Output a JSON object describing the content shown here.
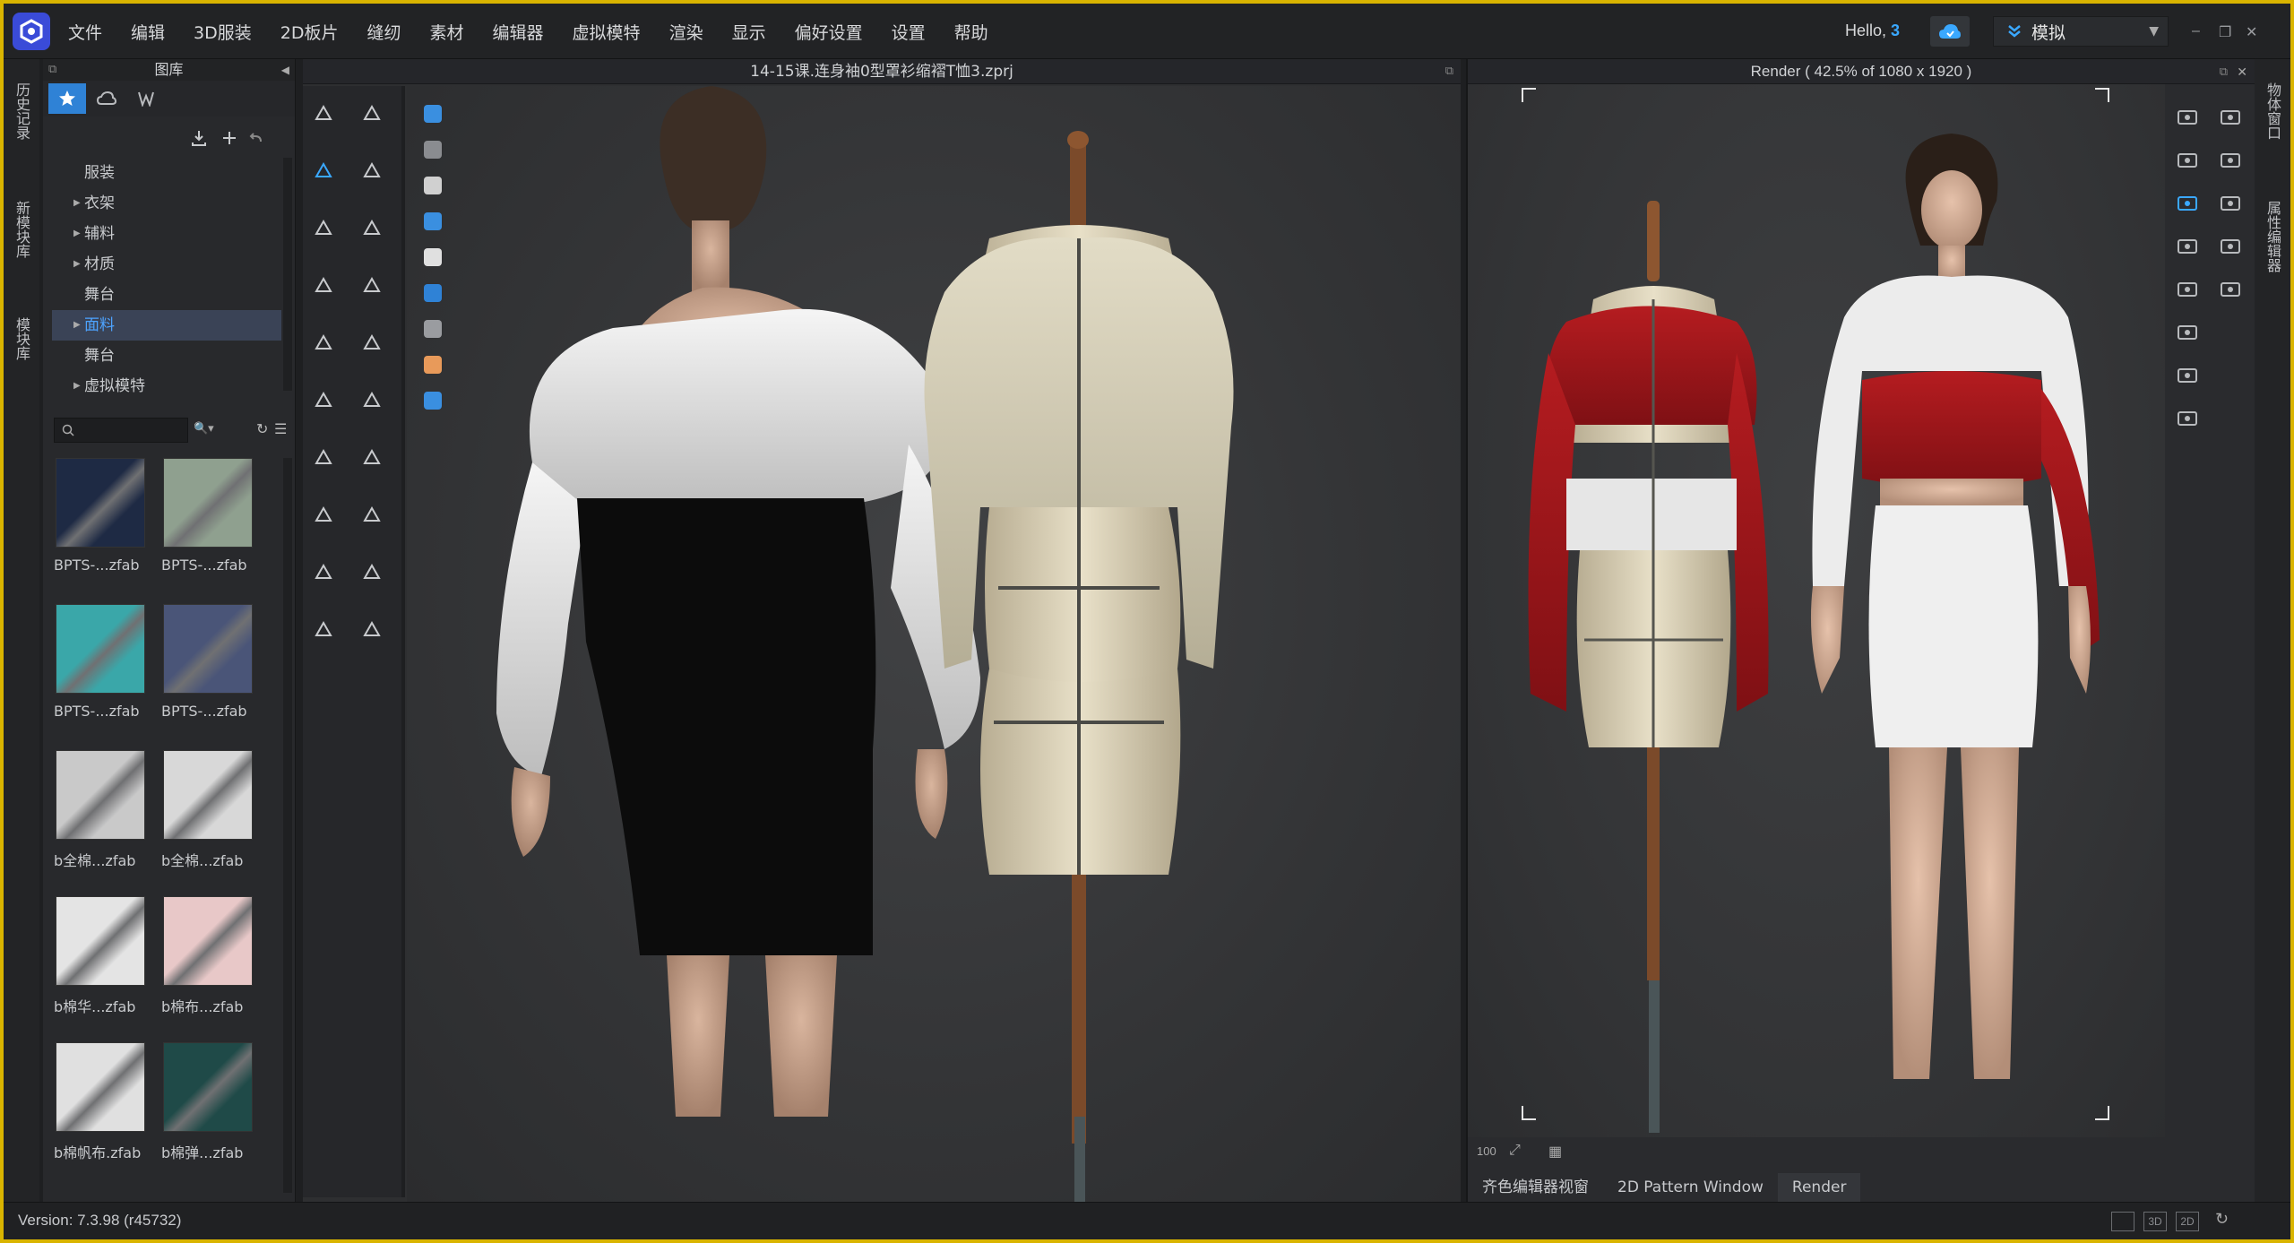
{
  "menu": {
    "items": [
      "文件",
      "编辑",
      "3D服装",
      "2D板片",
      "缝纫",
      "素材",
      "编辑器",
      "虚拟模特",
      "渲染",
      "显示",
      "偏好设置",
      "设置",
      "帮助"
    ],
    "hello_prefix": "Hello,",
    "hello_count": "3",
    "mode": "模拟"
  },
  "left_tabs": [
    "历史记录",
    "新模块库",
    "模块库"
  ],
  "right_tabs": [
    "物体窗口",
    "属性编辑器"
  ],
  "library": {
    "title": "图库",
    "tree": [
      {
        "label": "服装",
        "arrow": false,
        "selected": false
      },
      {
        "label": "衣架",
        "arrow": true,
        "selected": false
      },
      {
        "label": "辅料",
        "arrow": true,
        "selected": false
      },
      {
        "label": "材质",
        "arrow": true,
        "selected": false
      },
      {
        "label": "舞台",
        "arrow": false,
        "selected": false
      },
      {
        "label": "面料",
        "arrow": true,
        "selected": true
      },
      {
        "label": "舞台",
        "arrow": false,
        "selected": false
      },
      {
        "label": "虚拟模特",
        "arrow": true,
        "selected": false
      }
    ],
    "thumbnails": [
      {
        "caption": "BPTS-...zfab",
        "color": "#1e2a44"
      },
      {
        "caption": "BPTS-...zfab",
        "color": "#8fa08f"
      },
      {
        "caption": "BPTS-...zfab",
        "color": "#3aa7a9"
      },
      {
        "caption": "BPTS-...zfab",
        "color": "#4a5578"
      },
      {
        "caption": "b全棉...zfab",
        "color": "#c9c9c9"
      },
      {
        "caption": "b全棉...zfab",
        "color": "#d8d8d8"
      },
      {
        "caption": "b棉华...zfab",
        "color": "#e4e4e4"
      },
      {
        "caption": "b棉布...zfab",
        "color": "#e8c8c8"
      },
      {
        "caption": "b棉帆布.zfab",
        "color": "#e0e0e0"
      },
      {
        "caption": "b棉弹...zfab",
        "color": "#1f4a48"
      }
    ]
  },
  "viewport3d": {
    "title": "14-15课.连身袖0型罩衫缩褶T恤3.zprj"
  },
  "render": {
    "title": "Render ( 42.5% of 1080 x 1920 )",
    "bottom_tabs": [
      "齐色编辑器视窗",
      "2D Pattern Window",
      "Render"
    ],
    "active_tab": "Render"
  },
  "status": {
    "version": "Version: 7.3.98 (r45732)",
    "view_icons": [
      "3D",
      "2D"
    ]
  },
  "colors": {
    "accent": "#2f82d6",
    "border": "#d9b400",
    "red_top": "#9a1418",
    "cream_fabric": "#d8d2ba",
    "black_skirt": "#0c0c0c"
  }
}
